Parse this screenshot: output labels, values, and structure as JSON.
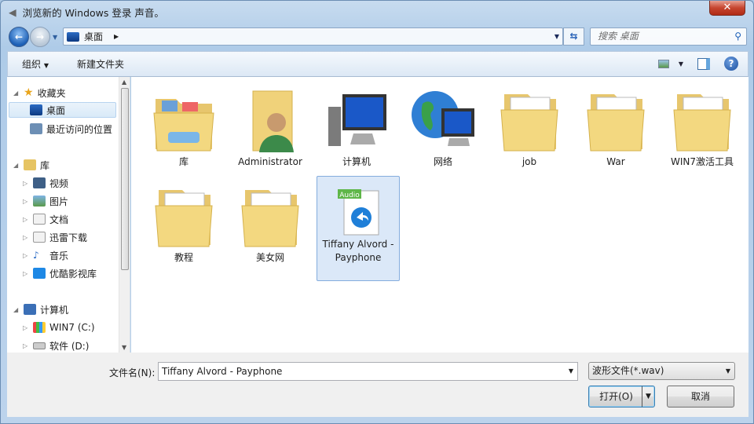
{
  "window": {
    "title": "浏览新的 Windows 登录 声音。",
    "close": "✕"
  },
  "nav": {
    "location": "桌面",
    "search_placeholder": "搜索 桌面"
  },
  "toolbar": {
    "organize": "组织",
    "new_folder": "新建文件夹"
  },
  "sidebar": {
    "favorites": "收藏夹",
    "desktop": "桌面",
    "recent": "最近访问的位置",
    "libraries": "库",
    "video": "视频",
    "pictures": "图片",
    "documents": "文档",
    "xunlei": "迅雷下载",
    "music": "音乐",
    "youku": "优酷影视库",
    "computer": "计算机",
    "drive_c": "WIN7 (C:)",
    "drive_d": "软件 (D:)"
  },
  "items": [
    "库",
    "Administrator",
    "计算机",
    "网络",
    "job",
    "War",
    "WIN7激活工具",
    "教程",
    "美女网",
    "Tiffany Alvord - Payphone"
  ],
  "audio_badge": "Audio",
  "bottom": {
    "filename_label": "文件名(N):",
    "filename": "Tiffany Alvord - Payphone",
    "filetype": "波形文件(*.wav)",
    "open": "打开(O)",
    "cancel": "取消"
  }
}
